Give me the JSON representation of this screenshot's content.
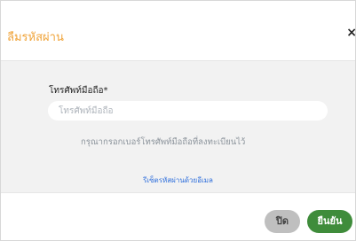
{
  "modal": {
    "title": "ลืมรหัสผ่าน",
    "close_symbol": "×"
  },
  "form": {
    "phone_label": "โทรศัพท์มือถือ*",
    "phone_placeholder": "โทรศัพท์มือถือ",
    "phone_value": "",
    "hint": "กรุณากรอกเบอร์โทรศัพท์มือถือที่ลงทะเบียนไว้",
    "email_reset_link": "รีเซ็ตรหัสผ่านด้วยอีเมล"
  },
  "footer": {
    "close_button": "ปิด",
    "confirm_button": "ยืนยัน"
  },
  "colors": {
    "title": "#f0a43a",
    "body_bg": "#f2f2f2",
    "link": "#2f6fdc",
    "confirm": "#3f8c3b",
    "close_btn": "#bfbfbf"
  }
}
